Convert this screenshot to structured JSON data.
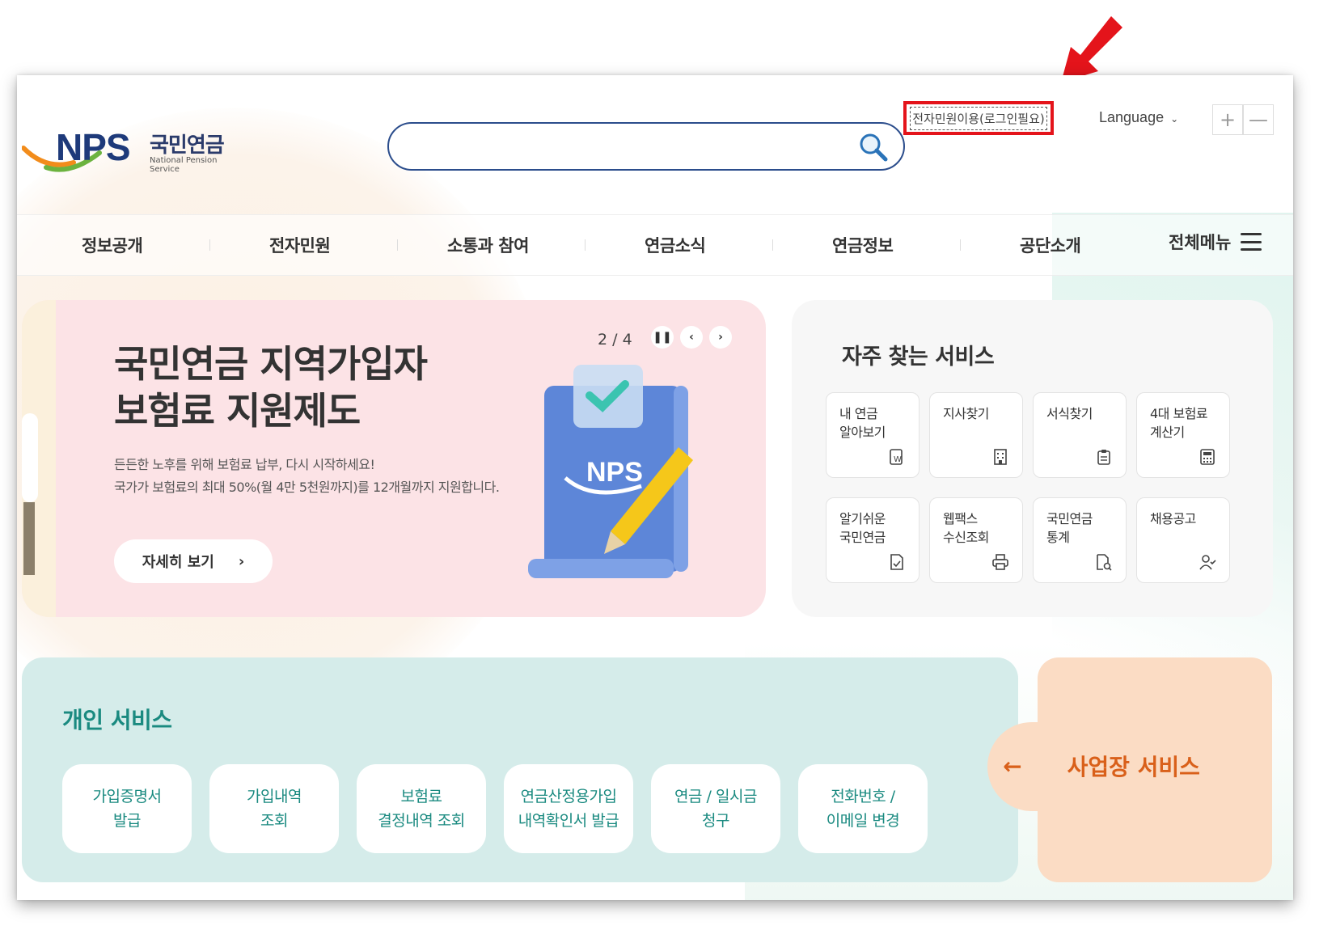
{
  "header": {
    "logo_text": "NPS",
    "logo_ko": "국민연금",
    "logo_en": "National Pension Service",
    "search": {
      "placeholder": "",
      "value": ""
    },
    "login_link": "전자민원이용(로그인필요)",
    "language": "Language",
    "zoom_in": "+",
    "zoom_out": "—"
  },
  "nav": {
    "items": [
      "정보공개",
      "전자민원",
      "소통과 참여",
      "연금소식",
      "연금정보",
      "공단소개"
    ],
    "all_menu": "전체메뉴"
  },
  "banner": {
    "title_line1": "국민연금 지역가입자",
    "title_line2": "보험료 지원제도",
    "desc_line1": "든든한 노후를 위해 보험료 납부, 다시 시작하세요!",
    "desc_line2": "국가가 보험료의 최대 50%(월 4만 5천원까지)를 12개월까지 지원합니다.",
    "more_label": "자세히 보기",
    "pager": "2 / 4",
    "art_text": "NPS"
  },
  "favorites": {
    "title": "자주 찾는 서비스",
    "items": [
      {
        "label": "내 연금\n알아보기",
        "icon": "won-document-icon"
      },
      {
        "label": "지사찾기",
        "icon": "building-icon"
      },
      {
        "label": "서식찾기",
        "icon": "clipboard-icon"
      },
      {
        "label": "4대 보험료\n계산기",
        "icon": "calculator-icon"
      },
      {
        "label": "알기쉬운\n국민연금",
        "icon": "check-document-icon"
      },
      {
        "label": "웹팩스\n수신조회",
        "icon": "printer-icon"
      },
      {
        "label": "국민연금\n통계",
        "icon": "search-document-icon"
      },
      {
        "label": "채용공고",
        "icon": "person-check-icon"
      }
    ]
  },
  "personal": {
    "title": "개인 서비스",
    "items": [
      "가입증명서\n발급",
      "가입내역\n조회",
      "보험료\n결정내역 조회",
      "연금산정용가입\n내역확인서 발급",
      "연금 / 일시금\n청구",
      "전화번호 /\n이메일 변경"
    ]
  },
  "business": {
    "label": "사업장 서비스",
    "arrow": "←"
  },
  "colors": {
    "accent_red": "#e4141b",
    "teal": "#1a8a80",
    "orange": "#d9601a",
    "navy": "#1e3a7a"
  }
}
